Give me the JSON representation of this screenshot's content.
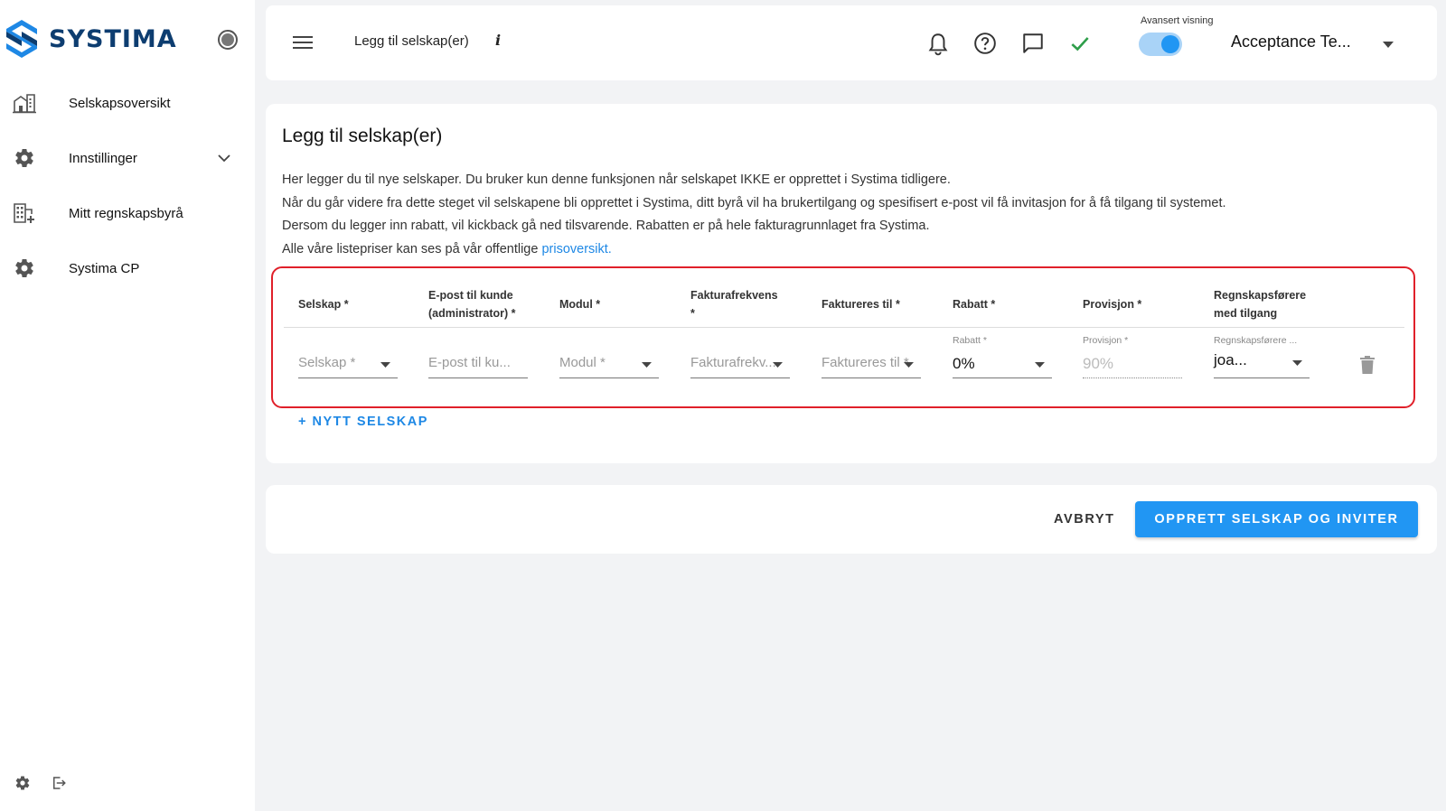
{
  "brand": {
    "name": "SYSTIMA",
    "color": "#0d3d70",
    "accent": "#2196f3"
  },
  "sidebar": {
    "items": [
      {
        "label": "Selskapsoversikt",
        "icon": "building-icon"
      },
      {
        "label": "Innstillinger",
        "icon": "gear-icon",
        "expandable": true
      },
      {
        "label": "Mitt regnskapsbyrå",
        "icon": "office-add-icon"
      },
      {
        "label": "Systima CP",
        "icon": "gear-icon"
      }
    ],
    "bottom_icons": [
      "settings-icon",
      "logout-icon"
    ]
  },
  "topbar": {
    "title": "Legg til selskap(er)",
    "info": "i",
    "toggle_label": "Avansert visning",
    "toggle_on": true,
    "account": "Acceptance Te...",
    "icons": [
      "bell-icon",
      "help-icon",
      "chat-icon",
      "check-icon"
    ]
  },
  "form": {
    "title": "Legg til selskap(er)",
    "description": [
      "Her legger du til nye selskaper. Du bruker kun denne funksjonen når selskapet IKKE er opprettet i Systima tidligere.",
      "Når du går videre fra dette steget vil selskapene bli opprettet i Systima, ditt byrå vil ha brukertilgang og spesifisert e-post vil få invitasjon for å få tilgang til systemet.",
      "Dersom du legger inn rabatt, vil kickback gå ned tilsvarende. Rabatten er på hele fakturagrunnlaget fra Systima."
    ],
    "price_line_prefix": "Alle våre listepriser kan ses på vår offentlige ",
    "price_link": "prisoversikt.",
    "columns": {
      "selskap": "Selskap *",
      "epost_1": "E-post til kunde",
      "epost_2": "(administrator) *",
      "modul": "Modul *",
      "frekvens_1": "Fakturafrekvens",
      "frekvens_2": "*",
      "faktureres": "Faktureres til *",
      "rabatt": "Rabatt *",
      "provisjon": "Provisjon *",
      "regnskap_1": "Regnskapsførere",
      "regnskap_2": "med tilgang"
    },
    "row": {
      "selskap_placeholder": "Selskap *",
      "epost_placeholder": "E-post til ku...",
      "modul_placeholder": "Modul *",
      "frekvens_placeholder": "Fakturafrekv...",
      "faktureres_placeholder": "Faktureres til *",
      "rabatt_label": "Rabatt *",
      "rabatt_value": "0%",
      "provisjon_label": "Provisjon *",
      "provisjon_value": "90%",
      "regnskap_label": "Regnskapsførere ...",
      "regnskap_value": "joa..."
    },
    "add_label": "+ NYTT SELSKAP"
  },
  "actions": {
    "cancel": "AVBRYT",
    "submit": "OPPRETT SELSKAP OG INVITER"
  }
}
